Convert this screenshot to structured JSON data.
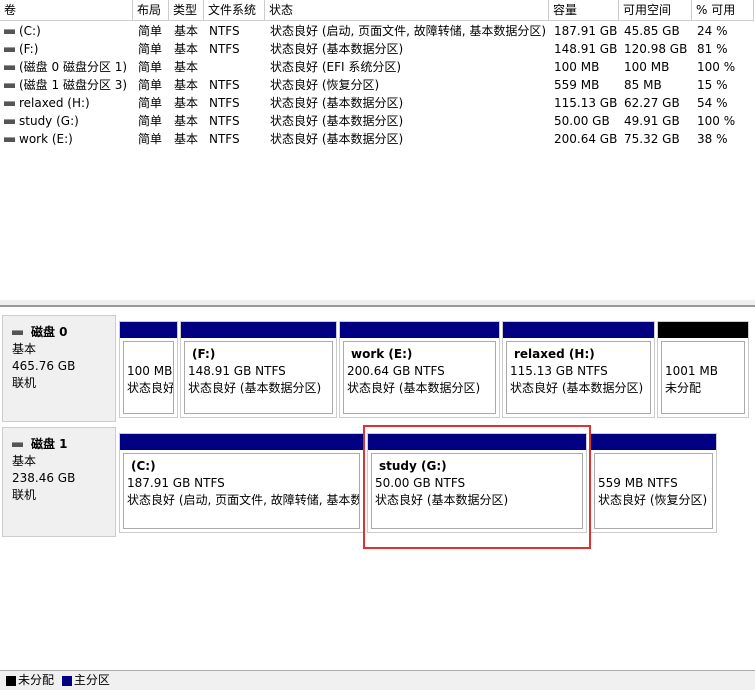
{
  "columns": [
    "卷",
    "布局",
    "类型",
    "文件系统",
    "状态",
    "容量",
    "可用空间",
    "% 可用"
  ],
  "volumes": [
    [
      "(C:)",
      "简单",
      "基本",
      "NTFS",
      "状态良好 (启动, 页面文件, 故障转储, 基本数据分区)",
      "187.91 GB",
      "45.85 GB",
      "24 %"
    ],
    [
      "(F:)",
      "简单",
      "基本",
      "NTFS",
      "状态良好 (基本数据分区)",
      "148.91 GB",
      "120.98 GB",
      "81 %"
    ],
    [
      "(磁盘 0 磁盘分区 1)",
      "简单",
      "基本",
      "",
      "状态良好 (EFI 系统分区)",
      "100 MB",
      "100 MB",
      "100 %"
    ],
    [
      "(磁盘 1 磁盘分区 3)",
      "简单",
      "基本",
      "NTFS",
      "状态良好 (恢复分区)",
      "559 MB",
      "85 MB",
      "15 %"
    ],
    [
      "relaxed (H:)",
      "简单",
      "基本",
      "NTFS",
      "状态良好 (基本数据分区)",
      "115.13 GB",
      "62.27 GB",
      "54 %"
    ],
    [
      "study (G:)",
      "简单",
      "基本",
      "NTFS",
      "状态良好 (基本数据分区)",
      "50.00 GB",
      "49.91 GB",
      "100 %"
    ],
    [
      "work (E:)",
      "简单",
      "基本",
      "NTFS",
      "状态良好 (基本数据分区)",
      "200.64 GB",
      "75.32 GB",
      "38 %"
    ]
  ],
  "disks": [
    {
      "name": "磁盘 0",
      "type": "基本",
      "size": "465.76 GB",
      "state": "联机",
      "parts": [
        {
          "title": "",
          "size": "100 MB",
          "status": "状态良好"
        },
        {
          "title": "(F:)",
          "size": "148.91 GB NTFS",
          "status": "状态良好 (基本数据分区)"
        },
        {
          "title": "work  (E:)",
          "size": "200.64 GB NTFS",
          "status": "状态良好 (基本数据分区)"
        },
        {
          "title": "relaxed  (H:)",
          "size": "115.13 GB NTFS",
          "status": "状态良好 (基本数据分区)"
        },
        {
          "title": "",
          "size": "1001 MB",
          "status": "未分配"
        }
      ]
    },
    {
      "name": "磁盘 1",
      "type": "基本",
      "size": "238.46 GB",
      "state": "联机",
      "parts": [
        {
          "title": "(C:)",
          "size": "187.91 GB NTFS",
          "status": "状态良好 (启动, 页面文件, 故障转储, 基本数据分区)"
        },
        {
          "title": "study  (G:)",
          "size": "50.00 GB NTFS",
          "status": "状态良好 (基本数据分区)"
        },
        {
          "title": "",
          "size": "559 MB NTFS",
          "status": "状态良好 (恢复分区)"
        }
      ]
    }
  ],
  "legend": {
    "unallocated": "未分配",
    "primary": "主分区"
  },
  "colors": {
    "primary": "#000080",
    "unallocated": "#000000",
    "highlight": "#e03030"
  }
}
